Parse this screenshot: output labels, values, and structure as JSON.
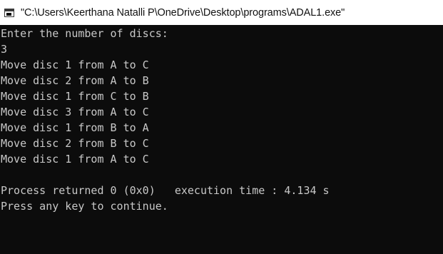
{
  "window": {
    "title": "\"C:\\Users\\Keerthana Natalli P\\OneDrive\\Desktop\\programs\\ADAL1.exe\"",
    "icon": "console-app-icon"
  },
  "console": {
    "lines": [
      "Enter the number of discs:",
      "3",
      "Move disc 1 from A to C",
      "Move disc 2 from A to B",
      "Move disc 1 from C to B",
      "Move disc 3 from A to C",
      "Move disc 1 from B to A",
      "Move disc 2 from B to C",
      "Move disc 1 from A to C",
      "",
      "Process returned 0 (0x0)   execution time : 4.134 s",
      "Press any key to continue."
    ]
  },
  "colors": {
    "background": "#0c0c0c",
    "text": "#c8c8c8",
    "titlebar": "#ffffff"
  }
}
